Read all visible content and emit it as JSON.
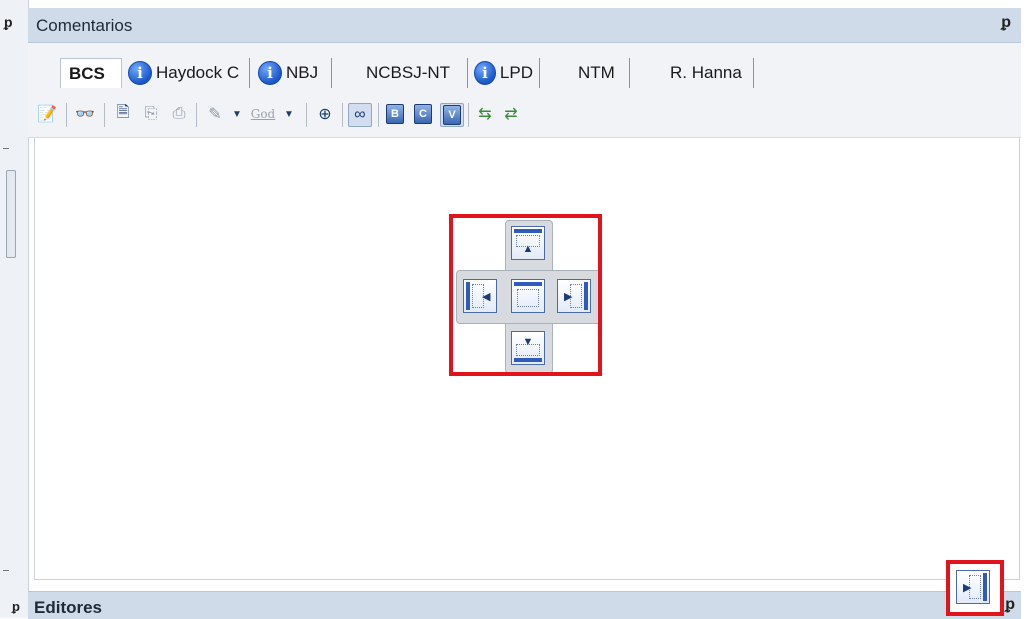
{
  "panel": {
    "title": "Comentarios",
    "pin": "p",
    "pin_glyph": "📌"
  },
  "tabs": [
    {
      "label": "BCS",
      "active": true,
      "info": false
    },
    {
      "label": "Haydock C",
      "active": false,
      "info": true
    },
    {
      "label": "NBJ",
      "active": false,
      "info": true
    },
    {
      "label": "NCBSJ-NT",
      "active": false,
      "info": false
    },
    {
      "label": "LPD",
      "active": false,
      "info": true
    },
    {
      "label": "NTM",
      "active": false,
      "info": false
    },
    {
      "label": "R. Hanna",
      "active": false,
      "info": false
    }
  ],
  "toolbar": {
    "god_label": "God"
  },
  "bottom_panel": {
    "title": "Editores"
  },
  "icons": {
    "pin": "pin-icon",
    "info": "info-icon",
    "dock_top": "dock-top-icon",
    "dock_left": "dock-left-icon",
    "dock_center": "dock-center-icon",
    "dock_right": "dock-right-icon",
    "dock_bottom": "dock-bottom-icon"
  },
  "colors": {
    "highlight": "#e0141a",
    "header": "#cfdbe9",
    "accent": "#2f5cb8"
  }
}
